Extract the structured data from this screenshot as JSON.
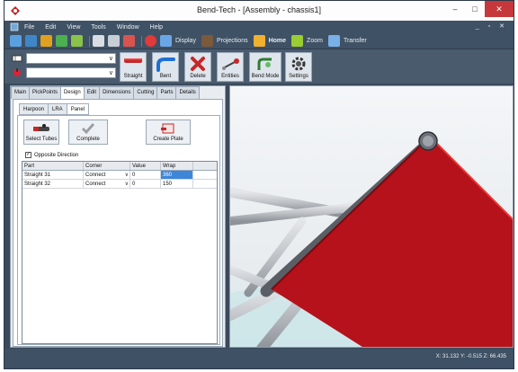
{
  "window": {
    "title": "Bend-Tech - [Assembly - chassis1]",
    "minimize": "–",
    "maximize": "□",
    "close": "✕"
  },
  "menu": {
    "items": [
      "File",
      "Edit",
      "View",
      "Tools",
      "Window",
      "Help"
    ],
    "mdi_controls": "_ ▫ ✕"
  },
  "quickbar": {
    "display": "Display",
    "projections": "Projections",
    "home": "Home",
    "zoom": "Zoom",
    "transfer": "Transfer"
  },
  "toolbar": {
    "tools": [
      "Straight",
      "Bent",
      "Delete",
      "Entities",
      "Bend Mode",
      "Settings"
    ]
  },
  "panel": {
    "tabs": [
      "Main",
      "PickPoints",
      "Design",
      "Edit",
      "Dimensions",
      "Cutting",
      "Parts",
      "Details"
    ],
    "active_tab": "Design",
    "subtabs": [
      "Harpoon",
      "LRA",
      "Panel"
    ],
    "active_subtab": "Panel",
    "buttons": {
      "select_tubes": "Select Tubes",
      "complete": "Complete",
      "create_plate": "Create Plate"
    },
    "opposite_direction": {
      "label": "Opposite Direction",
      "checked": "✓"
    },
    "grid": {
      "columns": [
        "Part",
        "Corner",
        "Value",
        "Wrap"
      ],
      "rows": [
        {
          "part": "Straight 31",
          "corner": "Connect",
          "value": "0",
          "wrap": "360"
        },
        {
          "part": "Straight 32",
          "corner": "Connect",
          "value": "0",
          "wrap": "150"
        }
      ]
    }
  },
  "status": {
    "coords": "X: 31.132  Y: -0.515  Z: 66.435"
  },
  "colors": {
    "plate_red": "#b5121b",
    "tube_gray": "#c9ccd0",
    "selection_blue": "#3d86d8"
  }
}
